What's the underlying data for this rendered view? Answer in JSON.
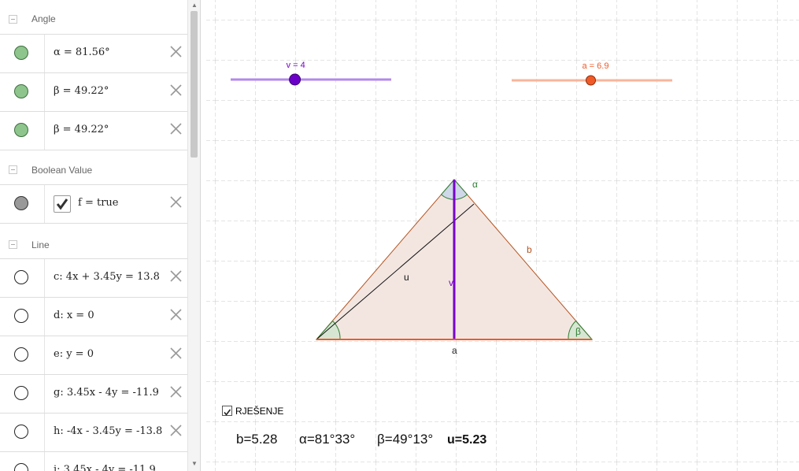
{
  "algebra": {
    "angle_header": "Angle",
    "angle_rows": [
      {
        "expr": "α = 81.56°"
      },
      {
        "expr": "β = 49.22°"
      },
      {
        "expr": "β  = 49.22°"
      }
    ],
    "boolean_header": "Boolean Value",
    "boolean_row": {
      "expr": "f = true",
      "checked": true
    },
    "line_header": "Line",
    "line_rows": [
      {
        "expr": "c: 4x + 3.45y = 13.8"
      },
      {
        "expr": "d: x = 0"
      },
      {
        "expr": "e: y = 0"
      },
      {
        "expr": "g: 3.45x - 4y = -11.9"
      },
      {
        "expr": "h: -4x - 3.45y = -13.8"
      },
      {
        "expr": "i: 3.45x - 4y = -11.9"
      }
    ]
  },
  "graphics": {
    "slider_v": {
      "label": "v = 4",
      "value": 4,
      "min": 0,
      "max": 10,
      "color": "#7a00cc"
    },
    "slider_a": {
      "label": "a = 6.9",
      "value": 6.9,
      "min": 0,
      "max": 14,
      "color": "#f05a28"
    },
    "labels": {
      "alpha": "α",
      "beta": "β",
      "b": "b",
      "a": "a",
      "u": "u",
      "v": "v"
    },
    "solution": {
      "checkbox_label": "RJEŠENJE",
      "checked": true,
      "b": "b=5.28",
      "alpha": "α=81°33°",
      "beta": "β=49°13°",
      "u": "u=5.23"
    }
  },
  "colors": {
    "triangle_fill": "#f3e6e1",
    "triangle_edge": "#b5531e",
    "base": "#f05a28",
    "height": "#7a00cc",
    "angle_green": "#2e7d32"
  }
}
